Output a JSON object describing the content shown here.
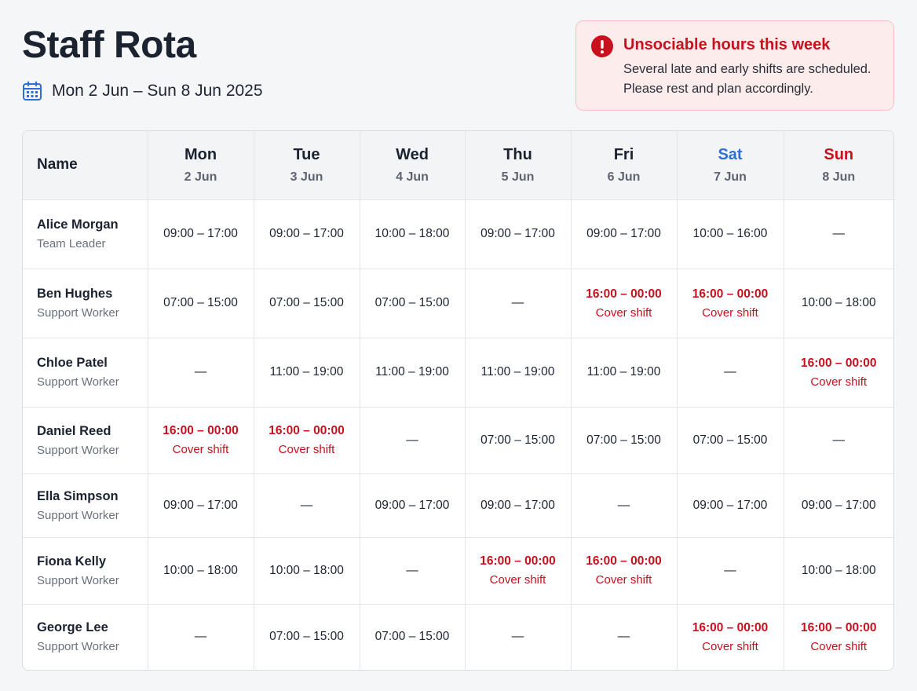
{
  "header": {
    "title": "Staff Rota",
    "date_range": "Mon 2 Jun – Sun 8 Jun 2025",
    "calendar_icon": "calendar-icon"
  },
  "alert": {
    "icon": "exclamation-circle-icon",
    "title": "Unsociable hours this week",
    "message_line1": "Several late and early shifts are scheduled.",
    "message_line2": "Please rest and plan accordingly.",
    "color": "#c8101e"
  },
  "colors": {
    "weekend_saturday": "#2f6ed6",
    "weekend_sunday": "#c8101e",
    "late_shift": "#c8101e",
    "calendar_icon": "#2f6ed6"
  },
  "table": {
    "name_header": "Name",
    "days": [
      {
        "name": "Mon",
        "date": "2 Jun"
      },
      {
        "name": "Tue",
        "date": "3 Jun"
      },
      {
        "name": "Wed",
        "date": "4 Jun"
      },
      {
        "name": "Thu",
        "date": "5 Jun"
      },
      {
        "name": "Fri",
        "date": "6 Jun"
      },
      {
        "name": "Sat",
        "date": "7 Jun"
      },
      {
        "name": "Sun",
        "date": "8 Jun"
      }
    ],
    "rows": [
      {
        "name": "Alice Morgan",
        "role": "Team Leader",
        "shifts": [
          {
            "time": "09:00 – 17:00"
          },
          {
            "time": "09:00 – 17:00"
          },
          {
            "time": "10:00 – 18:00"
          },
          {
            "time": "09:00 – 17:00"
          },
          {
            "time": "09:00 – 17:00"
          },
          {
            "time": "10:00 – 16:00"
          },
          {
            "time": "—"
          }
        ]
      },
      {
        "name": "Ben Hughes",
        "role": "Support Worker",
        "shifts": [
          {
            "time": "07:00 – 15:00"
          },
          {
            "time": "07:00 – 15:00"
          },
          {
            "time": "07:00 – 15:00"
          },
          {
            "time": "—"
          },
          {
            "time": "16:00 – 00:00",
            "note": "Cover shift"
          },
          {
            "time": "16:00 – 00:00",
            "note": "Cover shift"
          },
          {
            "time": "10:00 – 18:00"
          }
        ]
      },
      {
        "name": "Chloe Patel",
        "role": "Support Worker",
        "shifts": [
          {
            "time": "—"
          },
          {
            "time": "11:00 – 19:00"
          },
          {
            "time": "11:00 – 19:00"
          },
          {
            "time": "11:00 – 19:00"
          },
          {
            "time": "11:00 – 19:00"
          },
          {
            "time": "—"
          },
          {
            "time": "16:00 – 00:00",
            "note": "Cover shift"
          }
        ]
      },
      {
        "name": "Daniel Reed",
        "role": "Support Worker",
        "shifts": [
          {
            "time": "16:00 – 00:00",
            "note": "Cover shift"
          },
          {
            "time": "16:00 – 00:00",
            "note": "Cover shift"
          },
          {
            "time": "—"
          },
          {
            "time": "07:00 – 15:00"
          },
          {
            "time": "07:00 – 15:00"
          },
          {
            "time": "07:00 – 15:00"
          },
          {
            "time": "—"
          }
        ]
      },
      {
        "name": "Ella Simpson",
        "role": "Support Worker",
        "shifts": [
          {
            "time": "09:00 – 17:00"
          },
          {
            "time": "—"
          },
          {
            "time": "09:00 – 17:00"
          },
          {
            "time": "09:00 – 17:00"
          },
          {
            "time": "—"
          },
          {
            "time": "09:00 – 17:00"
          },
          {
            "time": "09:00 – 17:00"
          }
        ]
      },
      {
        "name": "Fiona Kelly",
        "role": "Support Worker",
        "shifts": [
          {
            "time": "10:00 – 18:00"
          },
          {
            "time": "10:00 – 18:00"
          },
          {
            "time": "—"
          },
          {
            "time": "16:00 – 00:00",
            "note": "Cover shift"
          },
          {
            "time": "16:00 – 00:00",
            "note": "Cover shift"
          },
          {
            "time": "—"
          },
          {
            "time": "10:00 – 18:00"
          }
        ]
      },
      {
        "name": "George Lee",
        "role": "Support Worker",
        "shifts": [
          {
            "time": "—"
          },
          {
            "time": "07:00 – 15:00"
          },
          {
            "time": "07:00 – 15:00"
          },
          {
            "time": "—"
          },
          {
            "time": "—"
          },
          {
            "time": "16:00 – 00:00",
            "note": "Cover shift"
          },
          {
            "time": "16:00 – 00:00",
            "note": "Cover shift"
          }
        ]
      }
    ]
  }
}
